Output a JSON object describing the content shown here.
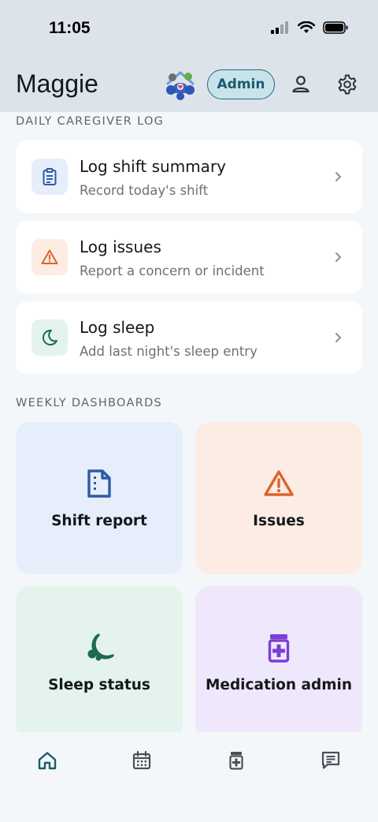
{
  "status_bar": {
    "time": "11:05"
  },
  "header": {
    "title": "Maggie",
    "logo_icon": "family-home-logo",
    "admin_label": "Admin",
    "profile_icon": "person-icon",
    "settings_icon": "gear-icon"
  },
  "daily_log": {
    "section_label": "DAILY CAREGIVER LOG",
    "items": [
      {
        "title": "Log shift summary",
        "subtitle": "Record today's shift",
        "icon": "clipboard-icon",
        "color": "#2f5aa8",
        "bg": "#e6eefb"
      },
      {
        "title": "Log issues",
        "subtitle": "Report a concern or incident",
        "icon": "warning-icon",
        "color": "#d9652b",
        "bg": "#fdece3"
      },
      {
        "title": "Log sleep",
        "subtitle": "Add last night's sleep entry",
        "icon": "moon-icon",
        "color": "#1c6b52",
        "bg": "#e4f3ec"
      }
    ]
  },
  "weekly_dashboards": {
    "section_label": "WEEKLY DASHBOARDS",
    "tiles": [
      {
        "label": "Shift report",
        "icon": "document-icon",
        "color": "#2f5aa8",
        "bg": "#e6eefb"
      },
      {
        "label": "Issues",
        "icon": "warning-icon",
        "color": "#d9652b",
        "bg": "#fdece3"
      },
      {
        "label": "Sleep status",
        "icon": "moon-icon",
        "color": "#1c6b52",
        "bg": "#e4f3ec"
      },
      {
        "label": "Medication admin",
        "icon": "medication-icon",
        "color": "#7a3fd6",
        "bg": "#efe7fc"
      }
    ]
  },
  "bottom_nav": [
    {
      "icon": "home-icon",
      "active": true
    },
    {
      "icon": "calendar-icon",
      "active": false
    },
    {
      "icon": "medication-icon",
      "active": false
    },
    {
      "icon": "chat-icon",
      "active": false
    }
  ],
  "colors": {
    "header_bg": "#dde3ea",
    "page_bg": "#f4f7fa",
    "accent": "#1f6b7d"
  }
}
